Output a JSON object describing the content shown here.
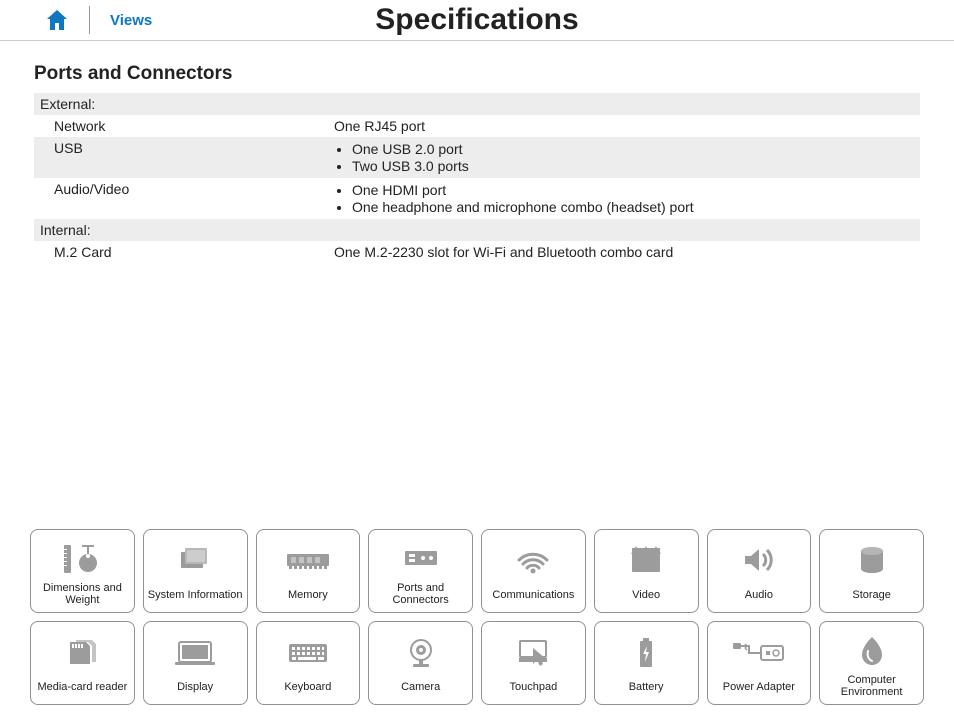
{
  "header": {
    "views_label": "Views",
    "title": "Specifications"
  },
  "section": {
    "title": "Ports and Connectors",
    "groups": [
      {
        "label": "External:",
        "rows": [
          {
            "label": "Network",
            "value": "One RJ45 port",
            "list": null,
            "shaded": false
          },
          {
            "label": "USB",
            "value": null,
            "list": [
              "One USB 2.0 port",
              "Two USB 3.0 ports"
            ],
            "shaded": true
          },
          {
            "label": "Audio/Video",
            "value": null,
            "list": [
              "One HDMI port",
              "One headphone and microphone combo (headset) port"
            ],
            "shaded": false
          }
        ]
      },
      {
        "label": "Internal:",
        "rows": [
          {
            "label": "M.2 Card",
            "value": "One M.2-2230 slot for Wi-Fi and Bluetooth combo card",
            "list": null,
            "shaded": false
          }
        ]
      }
    ]
  },
  "nav": [
    {
      "id": "dimensions",
      "label": "Dimensions and Weight"
    },
    {
      "id": "sysinfo",
      "label": "System Information"
    },
    {
      "id": "memory",
      "label": "Memory"
    },
    {
      "id": "ports",
      "label": "Ports and Connectors"
    },
    {
      "id": "comms",
      "label": "Communications"
    },
    {
      "id": "video",
      "label": "Video"
    },
    {
      "id": "audio",
      "label": "Audio"
    },
    {
      "id": "storage",
      "label": "Storage"
    },
    {
      "id": "mediacard",
      "label": "Media-card reader"
    },
    {
      "id": "display",
      "label": "Display"
    },
    {
      "id": "keyboard",
      "label": "Keyboard"
    },
    {
      "id": "camera",
      "label": "Camera"
    },
    {
      "id": "touchpad",
      "label": "Touchpad"
    },
    {
      "id": "battery",
      "label": "Battery"
    },
    {
      "id": "poweradapter",
      "label": "Power Adapter"
    },
    {
      "id": "environment",
      "label": "Computer Environment"
    }
  ]
}
